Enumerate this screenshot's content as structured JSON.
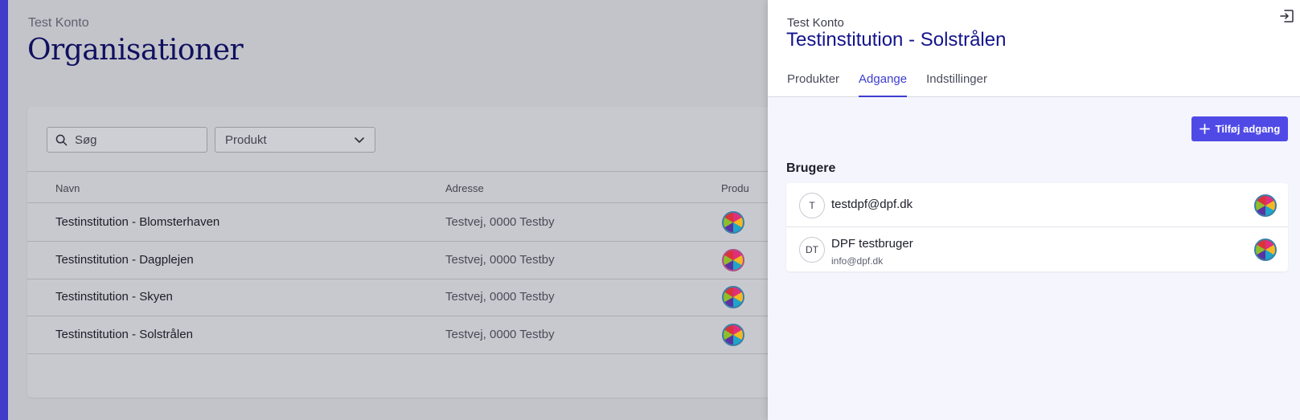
{
  "account": "Test Konto",
  "page_title": "Organisationer",
  "search": {
    "placeholder": "Søg"
  },
  "product_filter": {
    "label": "Produkt"
  },
  "table": {
    "columns": [
      "Navn",
      "Adresse",
      "Produ"
    ],
    "rows": [
      {
        "name": "Testinstitution - Blomsterhaven",
        "address": "Testvej, 0000 Testby"
      },
      {
        "name": "Testinstitution - Dagplejen",
        "address": "Testvej, 0000 Testby"
      },
      {
        "name": "Testinstitution - Skyen",
        "address": "Testvej, 0000 Testby"
      },
      {
        "name": "Testinstitution - Solstrålen",
        "address": "Testvej, 0000 Testby"
      }
    ]
  },
  "panel": {
    "account": "Test Konto",
    "title": "Testinstitution - Solstrålen",
    "tabs": [
      {
        "label": "Produkter",
        "active": false
      },
      {
        "label": "Adgange",
        "active": true
      },
      {
        "label": "Indstillinger",
        "active": false
      }
    ],
    "add_button": "Tilføj adgang",
    "users_heading": "Brugere",
    "users": [
      {
        "initials": "T",
        "name": "testdpf@dpf.dk",
        "email": ""
      },
      {
        "initials": "DT",
        "name": "DPF testbruger",
        "email": "info@dpf.dk"
      }
    ]
  },
  "icons": {
    "search": "search-icon",
    "dropdown": "chevron-down-icon",
    "exit": "exit-icon",
    "add": "plus-icon",
    "product": "product-pie-icon"
  },
  "colors": {
    "accent": "#3d3cd0",
    "button": "#4f4ae6",
    "title": "#14148c",
    "sidebar_strip": "#3f3cc9"
  }
}
